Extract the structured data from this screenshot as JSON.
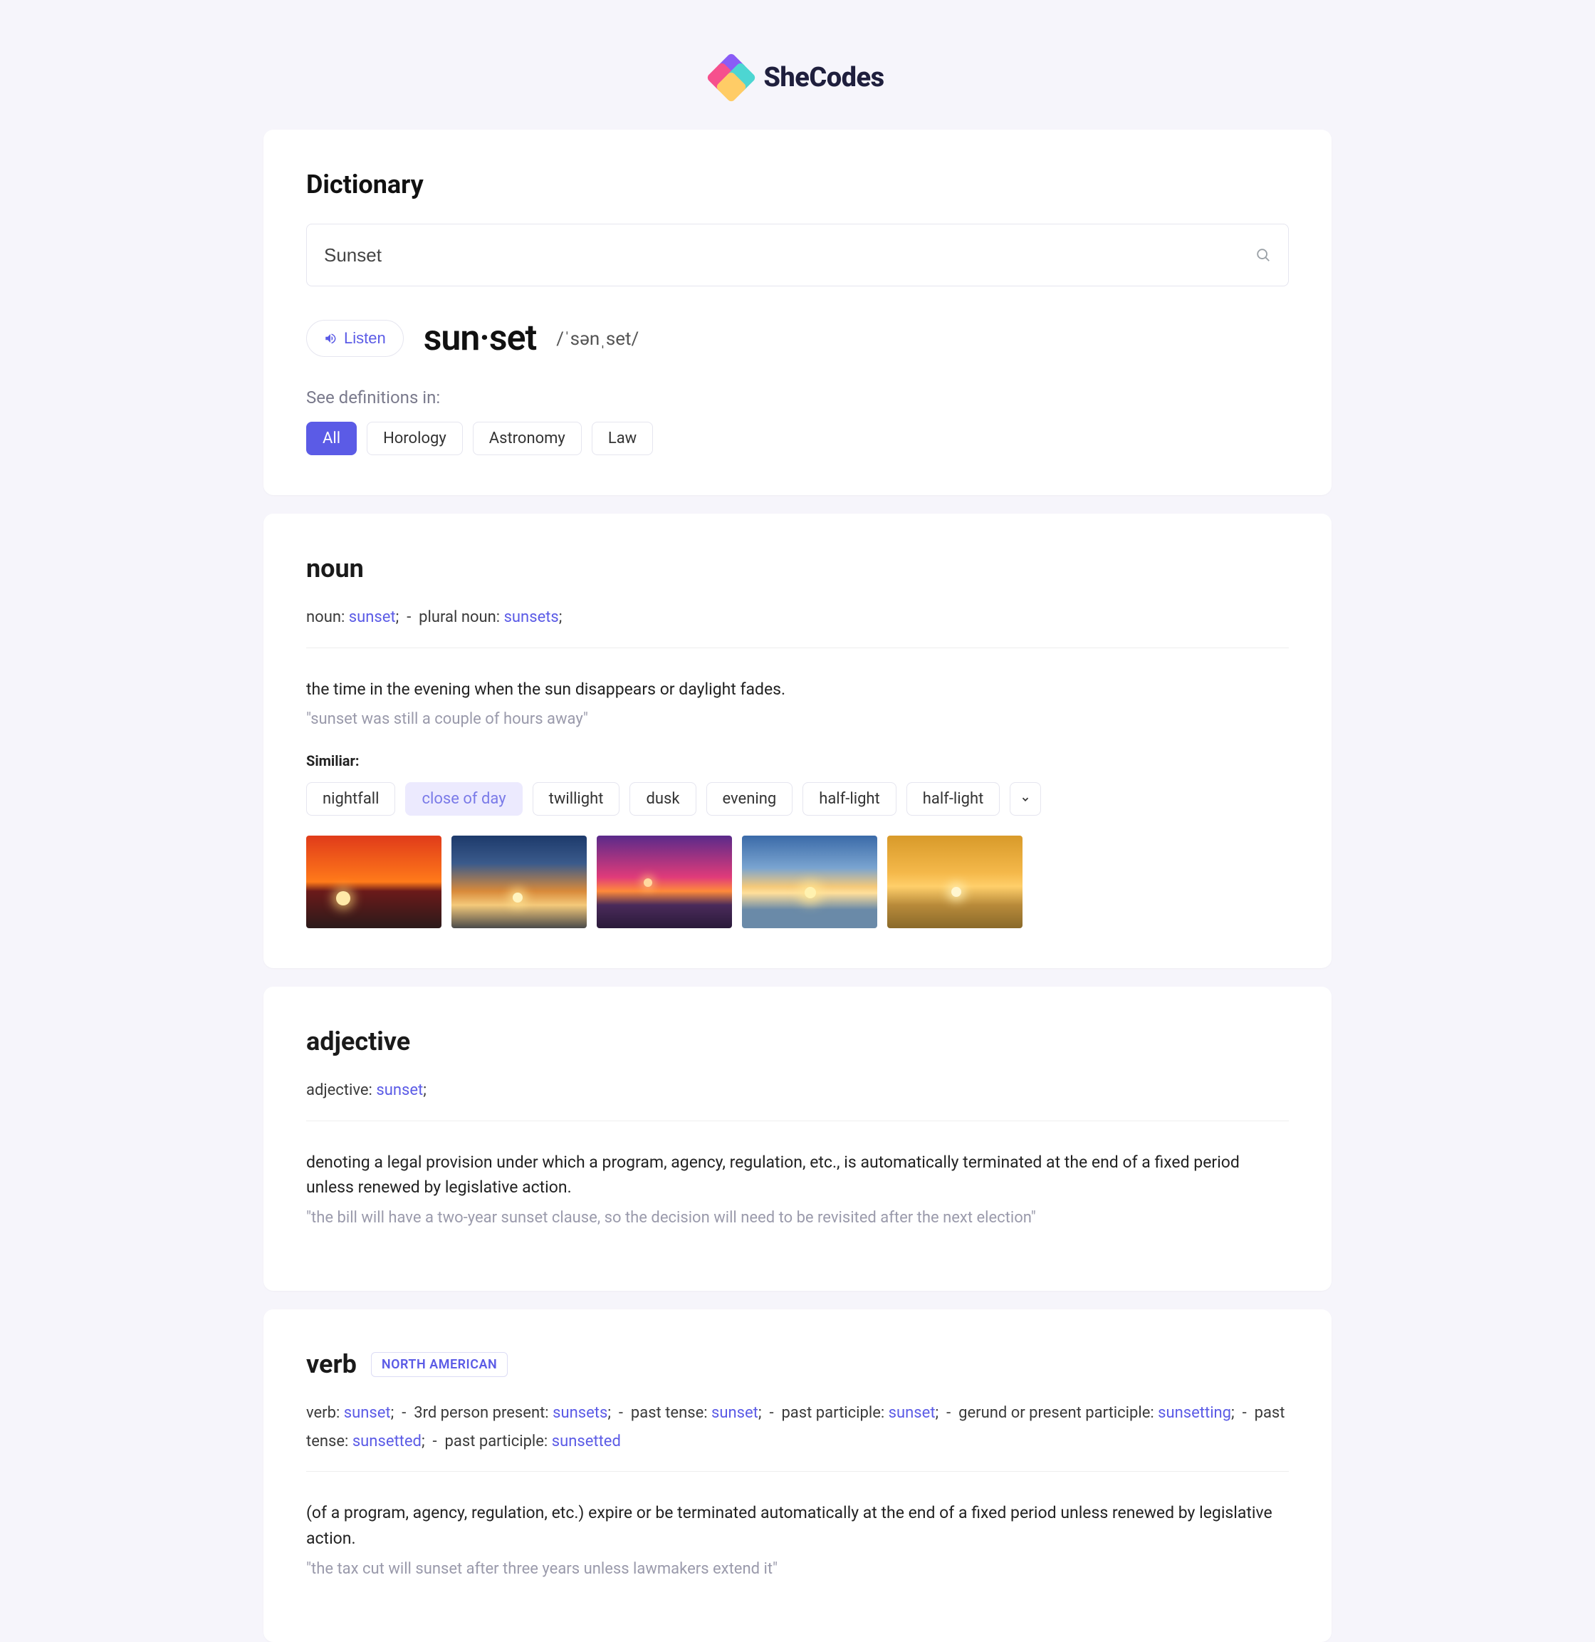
{
  "brand": "SheCodes",
  "header": {
    "title": "Dictionary",
    "search_value": "Sunset",
    "search_placeholder": "Search"
  },
  "word": {
    "listen_label": "Listen",
    "headword": "sun·set",
    "pronunciation": "/ˈsənˌset/",
    "see_definitions_label": "See definitions in:",
    "categories": [
      "All",
      "Horology",
      "Astronomy",
      "Law"
    ],
    "active_category": "All"
  },
  "entries": [
    {
      "pos": "noun",
      "region": "",
      "forms_html": "noun: <span class=\"kw\">sunset</span>;&nbsp;&nbsp;-&nbsp;&nbsp;plural noun: <span class=\"kw\">sunsets</span>;",
      "definition": "the time in the evening when the sun disappears or daylight fades.",
      "example": "\"sunset was still a couple of hours away\"",
      "similar_label": "Similiar:",
      "similar": [
        "nightfall",
        "close of day",
        "twillight",
        "dusk",
        "evening",
        "half-light",
        "half-light"
      ],
      "similar_highlight": "close of day",
      "show_images": true
    },
    {
      "pos": "adjective",
      "region": "",
      "forms_html": "adjective: <span class=\"kw\">sunset</span>;",
      "definition": "denoting a legal provision under which a program, agency, regulation, etc., is automatically terminated at the end of a fixed period unless renewed by legislative action.",
      "example": "\"the bill will have a two-year sunset clause, so the decision will need to be revisited after the next election\"",
      "similar_label": "",
      "similar": [],
      "show_images": false
    },
    {
      "pos": "verb",
      "region": "NORTH AMERICAN",
      "forms_html": "verb: <span class=\"kw\">sunset</span>;&nbsp;&nbsp;-&nbsp;&nbsp;3rd person present: <span class=\"kw\">sunsets</span>;&nbsp;&nbsp;-&nbsp;&nbsp;past tense: <span class=\"kw\">sunset</span>;&nbsp;&nbsp;-&nbsp;&nbsp;past participle: <span class=\"kw\">sunset</span>;&nbsp;&nbsp;-&nbsp;&nbsp;gerund or present participle: <span class=\"kw\">sunsetting</span>;&nbsp;&nbsp;-&nbsp;&nbsp;past tense: <span class=\"kw\">sunsetted</span>;&nbsp;&nbsp;-&nbsp;&nbsp;past participle: <span class=\"kw\">sunsetted</span>",
      "definition": "(of a program, agency, regulation, etc.) expire or be terminated automatically at the end of a fixed period unless renewed by legislative action.",
      "example": "\"the tax cut will sunset after three years unless lawmakers extend it\"",
      "similar_label": "",
      "similar": [],
      "show_images": false
    }
  ]
}
